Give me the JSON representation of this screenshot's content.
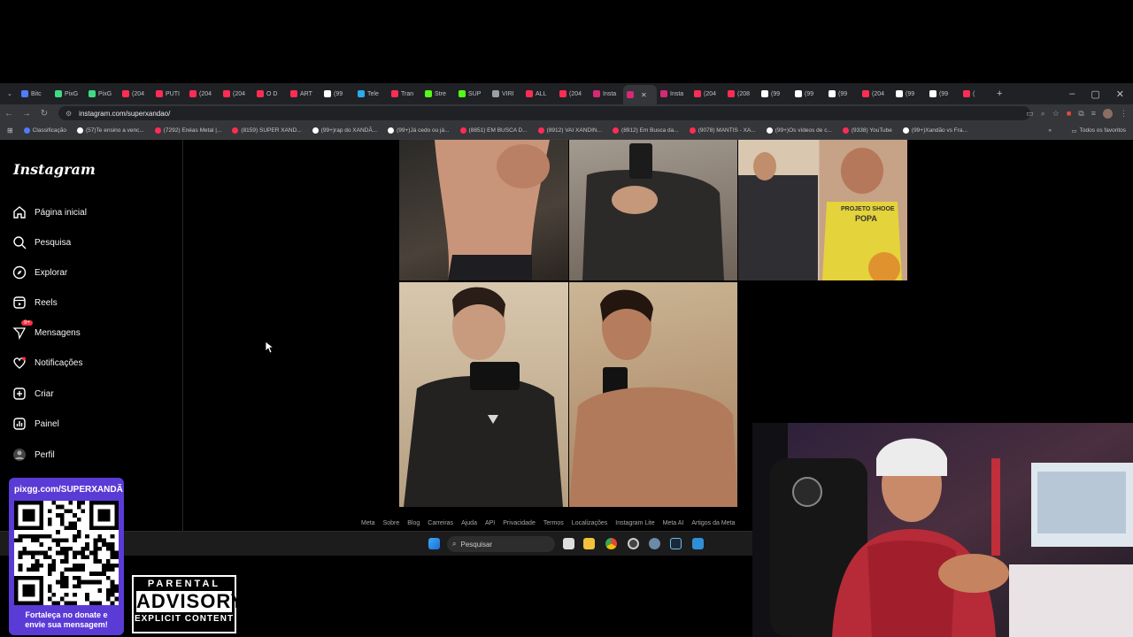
{
  "browser": {
    "tabs": [
      {
        "label": "Bitc",
        "color": "#4f7cff"
      },
      {
        "label": "PixG",
        "color": "#3ddc84"
      },
      {
        "label": "PixG",
        "color": "#3ddc84"
      },
      {
        "label": "(204",
        "color": "#ff2d55"
      },
      {
        "label": "PUTI",
        "color": "#ff2d55"
      },
      {
        "label": "(204",
        "color": "#ff2d55"
      },
      {
        "label": "(204",
        "color": "#ff2d55"
      },
      {
        "label": "O D",
        "color": "#ff2d55"
      },
      {
        "label": "ART",
        "color": "#ff2d55"
      },
      {
        "label": "(99",
        "color": "#ffffff"
      },
      {
        "label": "Tele",
        "color": "#2aabee"
      },
      {
        "label": "Tran",
        "color": "#ff2d55"
      },
      {
        "label": "Stre",
        "color": "#53fc18"
      },
      {
        "label": "SUP",
        "color": "#53fc18"
      },
      {
        "label": "VIRI",
        "color": "#9aa0a6"
      },
      {
        "label": "ALL",
        "color": "#ff2d55"
      },
      {
        "label": "(204",
        "color": "#ff2d55"
      },
      {
        "label": "Insta",
        "color": "#d62976"
      },
      {
        "label": "",
        "color": "#d62976",
        "active": true
      },
      {
        "label": "Insta",
        "color": "#d62976"
      },
      {
        "label": "(204",
        "color": "#ff2d55"
      },
      {
        "label": "(208",
        "color": "#ff2d55"
      },
      {
        "label": "(99",
        "color": "#ffffff"
      },
      {
        "label": "(99",
        "color": "#ffffff"
      },
      {
        "label": "(99",
        "color": "#ffffff"
      },
      {
        "label": "(204",
        "color": "#ff2d55"
      },
      {
        "label": "(99",
        "color": "#ffffff"
      },
      {
        "label": "(99",
        "color": "#ffffff"
      },
      {
        "label": "(",
        "color": "#ff2d55"
      }
    ],
    "url": "instagram.com/superxandao/",
    "bookmarks": [
      {
        "label": "Classificação",
        "color": "#4f7cff"
      },
      {
        "label": "(57)Te ensino a venc...",
        "color": "#ffffff"
      },
      {
        "label": "(7292) Enéas Metal |...",
        "color": "#ff2d55"
      },
      {
        "label": "(8159) SUPER XAND...",
        "color": "#ff2d55"
      },
      {
        "label": "(99+)rap do XANDÃ...",
        "color": "#ffffff"
      },
      {
        "label": "(99+)Já cedo ou já...",
        "color": "#ffffff"
      },
      {
        "label": "(8851) EM BUSCA D...",
        "color": "#ff2d55"
      },
      {
        "label": "(8912) VAI XANDIN...",
        "color": "#ff2d55"
      },
      {
        "label": "(8912) Em Busca da...",
        "color": "#ff2d55"
      },
      {
        "label": "(9078) MANTIS - XA...",
        "color": "#ff2d55"
      },
      {
        "label": "(99+)Os vídeos de c...",
        "color": "#ffffff"
      },
      {
        "label": "(9338) YouTube",
        "color": "#ff2d55"
      },
      {
        "label": "(99+)Xandão vs Fra...",
        "color": "#ffffff"
      }
    ],
    "favorites_label": "Todos os favoritos"
  },
  "instagram": {
    "logo": "Instagram",
    "nav": [
      {
        "key": "home",
        "label": "Página inicial"
      },
      {
        "key": "search",
        "label": "Pesquisa"
      },
      {
        "key": "explore",
        "label": "Explorar"
      },
      {
        "key": "reels",
        "label": "Reels"
      },
      {
        "key": "messages",
        "label": "Mensagens",
        "badge": "9+"
      },
      {
        "key": "notifications",
        "label": "Notificações"
      },
      {
        "key": "create",
        "label": "Criar"
      },
      {
        "key": "dashboard",
        "label": "Painel"
      },
      {
        "key": "profile",
        "label": "Perfil"
      }
    ],
    "footer": [
      "Meta",
      "Sobre",
      "Blog",
      "Carreiras",
      "Ajuda",
      "API",
      "Privacidade",
      "Termos",
      "Localizações",
      "Instagram Lite",
      "Meta AI",
      "Artigos da Meta"
    ],
    "poster_text": "PROJETO SHOOE POPA"
  },
  "taskbar": {
    "search_placeholder": "Pesquisar"
  },
  "overlay": {
    "qr_url": "pixgg.com/SUPERXANDÃ",
    "qr_message_1": "Fortaleça no donate e",
    "qr_message_2": "envie sua mensagem!",
    "advisory_1": "PARENTAL",
    "advisory_2": "ADVISORY",
    "advisory_3": "EXPLICIT CONTENT"
  },
  "colors": {
    "accent_badge": "#ff3040",
    "qr_bg": "#5b3bd6",
    "browser_bg": "#35363a"
  }
}
